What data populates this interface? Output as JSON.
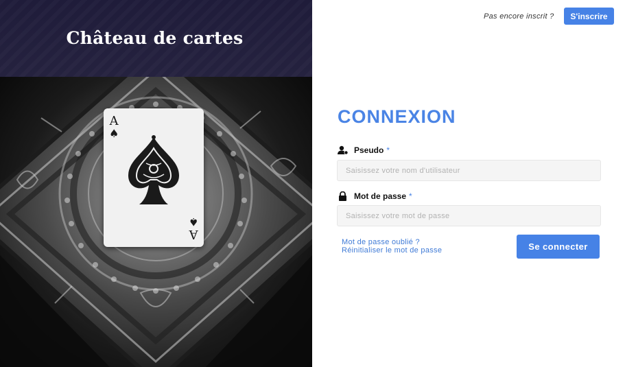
{
  "brand": {
    "title": "Château de cartes"
  },
  "card": {
    "rank": "A",
    "suit": "♠"
  },
  "header": {
    "prompt": "Pas encore inscrit ?",
    "signup_label": "S'inscrire"
  },
  "form": {
    "title": "CONNEXION",
    "username": {
      "label": "Pseudo",
      "required_mark": "*",
      "placeholder": "Saisissez votre nom d'utilisateur",
      "icon": "user-icon"
    },
    "password": {
      "label": "Mot de passe",
      "required_mark": "*",
      "placeholder": "Saisissez votre mot de passe",
      "icon": "lock-icon"
    },
    "forgot_link": "Mot de passe oublié ?",
    "reset_link": "Réinitialiser le mot de passe",
    "submit_label": "Se connecter"
  },
  "colors": {
    "accent": "#4682e6",
    "header_bg": "#211e3c"
  }
}
